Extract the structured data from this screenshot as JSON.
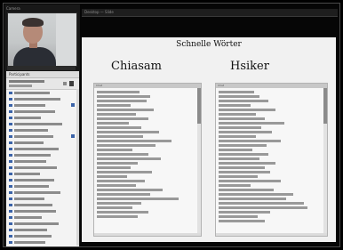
{
  "window": {
    "title": "Desktop — Slide"
  },
  "camera": {
    "title": "Camera"
  },
  "participants": {
    "header": "Participants",
    "rows": [
      {
        "w": 40,
        "mark": false
      },
      {
        "w": 52,
        "mark": false
      },
      {
        "w": 35,
        "mark": true
      },
      {
        "w": 46,
        "mark": false
      },
      {
        "w": 30,
        "mark": false
      },
      {
        "w": 54,
        "mark": false
      },
      {
        "w": 38,
        "mark": false
      },
      {
        "w": 44,
        "mark": true
      },
      {
        "w": 33,
        "mark": false
      },
      {
        "w": 50,
        "mark": false
      },
      {
        "w": 41,
        "mark": false
      },
      {
        "w": 36,
        "mark": false
      },
      {
        "w": 48,
        "mark": false
      },
      {
        "w": 29,
        "mark": false
      },
      {
        "w": 45,
        "mark": false
      },
      {
        "w": 39,
        "mark": false
      },
      {
        "w": 52,
        "mark": false
      },
      {
        "w": 34,
        "mark": false
      },
      {
        "w": 43,
        "mark": false
      },
      {
        "w": 47,
        "mark": false
      },
      {
        "w": 31,
        "mark": false
      },
      {
        "w": 50,
        "mark": false
      },
      {
        "w": 37,
        "mark": false
      },
      {
        "w": 42,
        "mark": false
      },
      {
        "w": 35,
        "mark": false
      }
    ]
  },
  "slide": {
    "title": "Schnelle Wörter",
    "left_heading": "Chiasam",
    "right_heading": "Hsiker",
    "left_box_header": "Chat",
    "right_box_header": "Chat",
    "left_lines": [
      48,
      60,
      56,
      38,
      64,
      44,
      58,
      36,
      50,
      70,
      52,
      84,
      66,
      40,
      58,
      72,
      46,
      38,
      62,
      34,
      54,
      44,
      74,
      60,
      92,
      50,
      40,
      58,
      46
    ],
    "right_lines": [
      40,
      46,
      56,
      36,
      64,
      42,
      52,
      74,
      48,
      60,
      42,
      70,
      54,
      38,
      56,
      46,
      64,
      52,
      58,
      44,
      70,
      36,
      62,
      84,
      76,
      96,
      100,
      58,
      44,
      52
    ]
  }
}
